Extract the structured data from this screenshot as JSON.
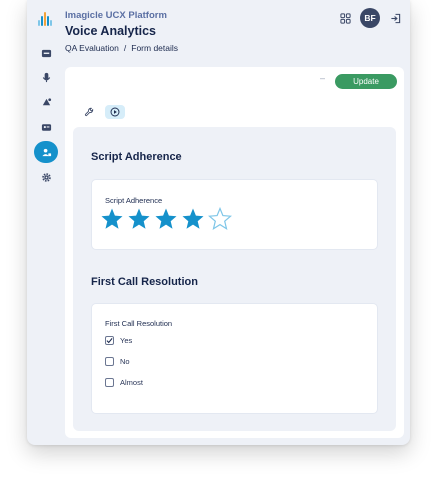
{
  "header": {
    "brand": "Imagicle UCX Platform",
    "app_title": "Voice Analytics",
    "breadcrumb": [
      "QA Evaluation",
      "/",
      "Form details"
    ],
    "avatar_initials": "BF",
    "icons": [
      "grid-icon",
      "logout-icon"
    ]
  },
  "sidebar": {
    "items": [
      {
        "icon": "dashboard-icon",
        "active": false
      },
      {
        "icon": "microphone-icon",
        "active": false
      },
      {
        "icon": "alert-icon",
        "active": false
      },
      {
        "icon": "contact-card-icon",
        "active": false
      },
      {
        "icon": "user-group-icon",
        "active": true
      },
      {
        "icon": "gear-icon",
        "active": false
      }
    ]
  },
  "toolbar": {
    "dash": "–",
    "update_label": "Update",
    "tools": [
      "wrench-icon",
      "play-circle-icon"
    ]
  },
  "sections": [
    {
      "title": "Script Adherence",
      "field_label": "Script Adherence",
      "type": "rating",
      "rating": 4,
      "max": 5
    },
    {
      "title": "First Call Resolution",
      "field_label": "First Call Resolution",
      "type": "checkboxes",
      "options": [
        {
          "label": "Yes",
          "checked": true
        },
        {
          "label": "No",
          "checked": false
        },
        {
          "label": "Almost",
          "checked": false
        }
      ]
    }
  ],
  "colors": {
    "accent": "#1591cb",
    "update": "#3a9a62",
    "star_filled": "#1591cb",
    "star_empty": "#7ec6e8",
    "title": "#16254a"
  }
}
